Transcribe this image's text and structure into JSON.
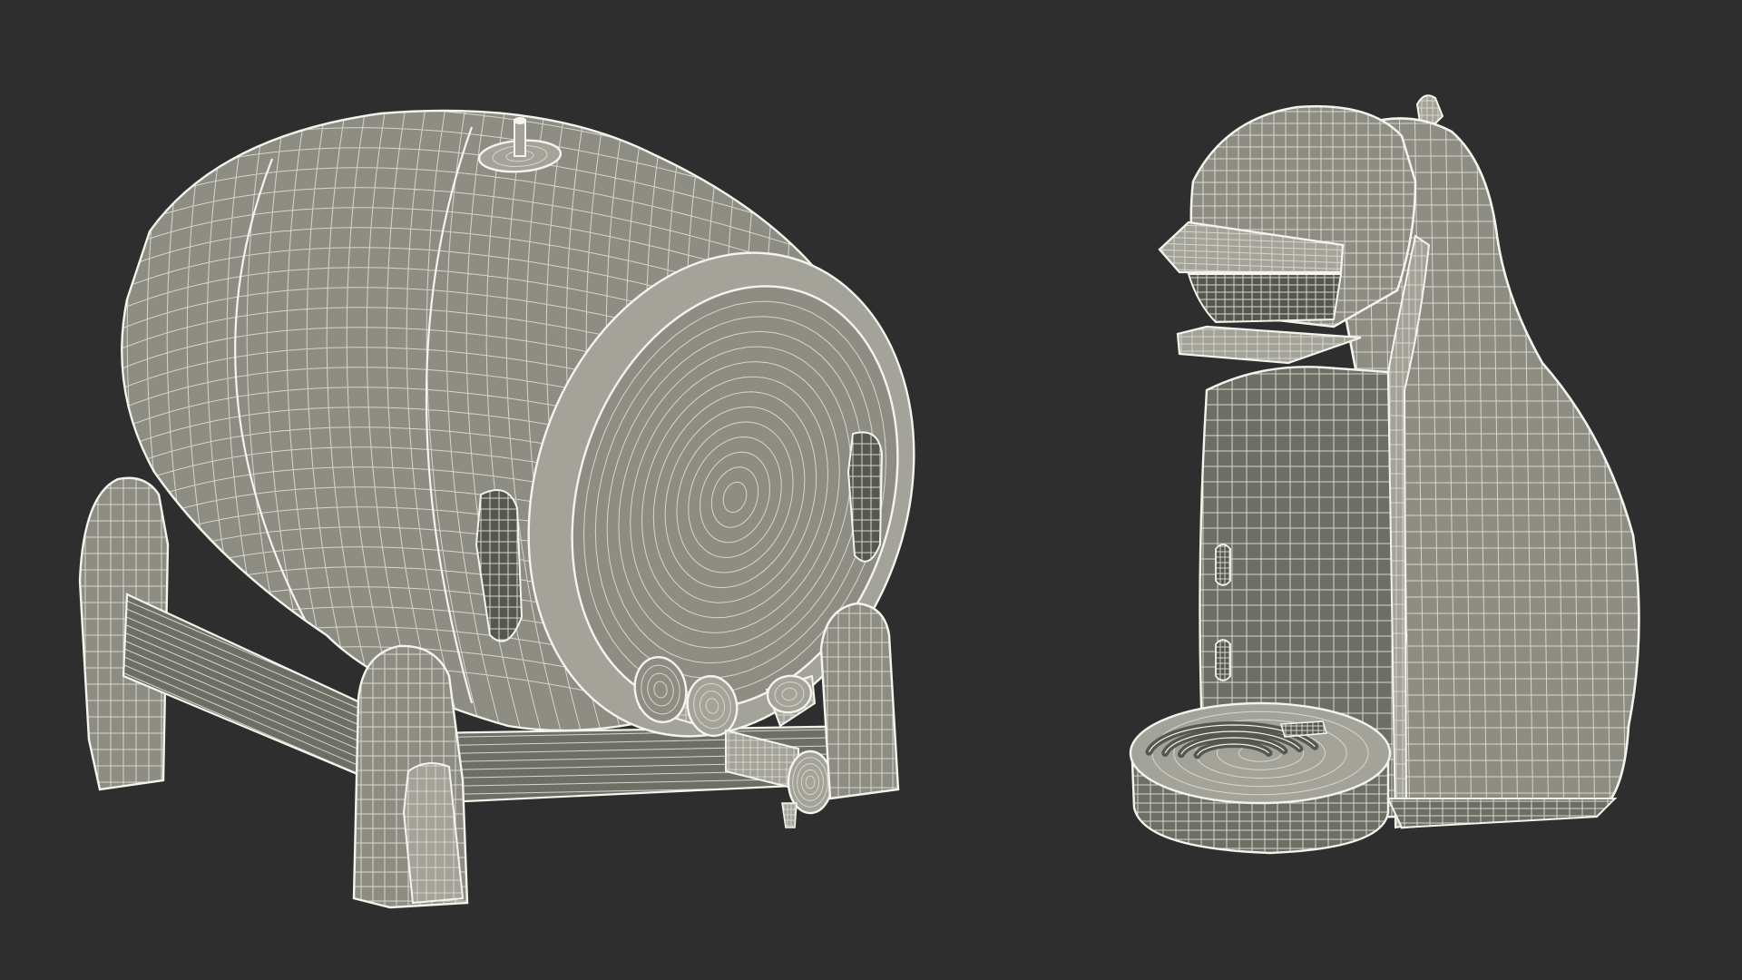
{
  "colors": {
    "background": "#2e2e2e",
    "surface": "#8d8d83",
    "surface_shadow": "#6d6e66",
    "surface_dark": "#56574f",
    "surface_light": "#a3a399",
    "wire": "#f4f4ec",
    "wire_soft": "#d6d6cc"
  }
}
